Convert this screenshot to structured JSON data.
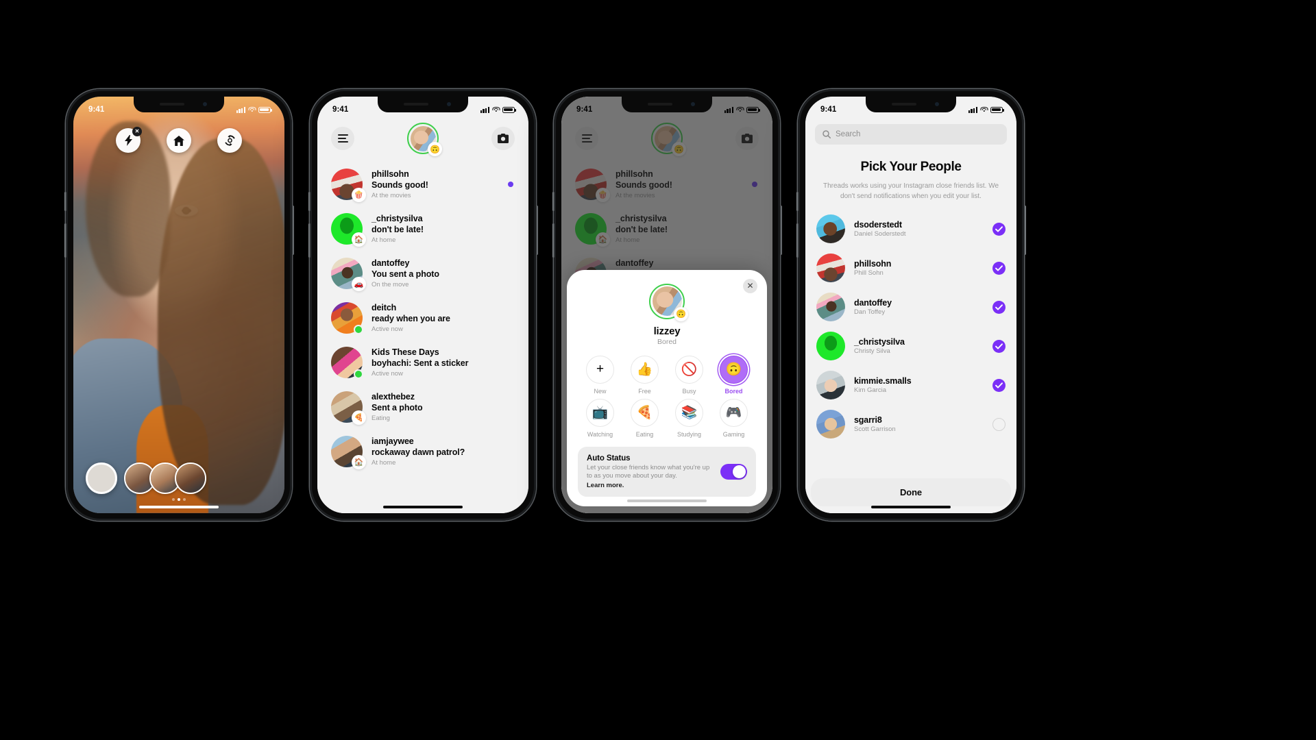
{
  "status_bar": {
    "time": "9:41"
  },
  "phone1": {
    "name": "camera-screen",
    "top_buttons": [
      {
        "name": "flash-off-button",
        "icon": "flash-off-icon"
      },
      {
        "name": "home-effects-button",
        "icon": "home-icon"
      },
      {
        "name": "flip-camera-button",
        "icon": "camera-flip-icon"
      }
    ],
    "shutter_label": "shutter-button",
    "favorites": [
      {
        "name": "favorite-1"
      },
      {
        "name": "favorite-2"
      },
      {
        "name": "favorite-3"
      }
    ],
    "page_dots": 3,
    "active_dot": 1
  },
  "phone2": {
    "header": {
      "menu_icon": "hamburger-icon",
      "camera_icon": "camera-icon",
      "me_emoji": "🙃",
      "me_name": "lizzey"
    },
    "threads": [
      {
        "name": "phillsohn",
        "message": "Sounds good!",
        "status": "At the movies",
        "badge": "🍿",
        "avatar": "pf-phill",
        "presence": "none",
        "unread": true
      },
      {
        "name": "_christysilva",
        "message": "don't be late!",
        "status": "At home",
        "badge": "🏠",
        "avatar": "pf-christy",
        "presence": "none",
        "unread": false
      },
      {
        "name": "dantoffey",
        "message": "You sent a photo",
        "status": "On the move",
        "badge": "🚗",
        "avatar": "pf-dan",
        "presence": "none",
        "unread": false
      },
      {
        "name": "deitch",
        "message": "ready when you are",
        "status": "Active now",
        "badge": "",
        "avatar": "pf-deitch",
        "presence": "online",
        "unread": false
      },
      {
        "name": "Kids These Days",
        "message": "boyhachi: Sent a sticker",
        "status": "Active now",
        "badge": "",
        "avatar": "pf-kids",
        "presence": "online",
        "unread": false
      },
      {
        "name": "alexthebez",
        "message": "Sent a photo",
        "status": "Eating",
        "badge": "🍕",
        "avatar": "pf-alex",
        "presence": "none",
        "unread": false
      },
      {
        "name": "iamjaywee",
        "message": "rockaway dawn patrol?",
        "status": "At home",
        "badge": "🏠",
        "avatar": "pf-jaywee",
        "presence": "none",
        "unread": false
      }
    ]
  },
  "phone3": {
    "modal": {
      "close_label": "✕",
      "profile_name": "lizzey",
      "profile_status": "Bored",
      "profile_emoji": "🙃",
      "statuses": [
        {
          "label": "New",
          "emoji": "+",
          "selected": false
        },
        {
          "label": "Free",
          "emoji": "👍",
          "selected": false
        },
        {
          "label": "Busy",
          "emoji": "🚫",
          "selected": false
        },
        {
          "label": "Bored",
          "emoji": "🙃",
          "selected": true
        },
        {
          "label": "Watching",
          "emoji": "📺",
          "selected": false
        },
        {
          "label": "Eating",
          "emoji": "🍕",
          "selected": false
        },
        {
          "label": "Studying",
          "emoji": "📚",
          "selected": false
        },
        {
          "label": "Gaming",
          "emoji": "🎮",
          "selected": false
        }
      ],
      "auto_status": {
        "title": "Auto Status",
        "description": "Let your close friends know what you're up to as you move about your day.",
        "learn_more": "Learn more.",
        "toggle_on": true,
        "toggle_color": "#7b2ff7"
      }
    }
  },
  "phone4": {
    "search": {
      "placeholder": "Search",
      "icon": "search-icon"
    },
    "title": "Pick Your People",
    "subtitle": "Threads works using your Instagram close friends list. We don't send notifications when you edit your list.",
    "people": [
      {
        "username": "dsoderstedt",
        "fullname": "Daniel Soderstedt",
        "selected": true,
        "avatar": "pf-dsod"
      },
      {
        "username": "phillsohn",
        "fullname": "Phill Sohn",
        "selected": true,
        "avatar": "pf-phill"
      },
      {
        "username": "dantoffey",
        "fullname": "Dan Toffey",
        "selected": true,
        "avatar": "pf-dan"
      },
      {
        "username": "_christysilva",
        "fullname": "Christy Silva",
        "selected": true,
        "avatar": "pf-christy"
      },
      {
        "username": "kimmie.smalls",
        "fullname": "Kim Garcia",
        "selected": true,
        "avatar": "pf-kimmie"
      },
      {
        "username": "sgarri8",
        "fullname": "Scott Garrison",
        "selected": false,
        "avatar": "pf-sgarri"
      }
    ],
    "done_label": "Done",
    "accent_color": "#7b2ff7"
  }
}
